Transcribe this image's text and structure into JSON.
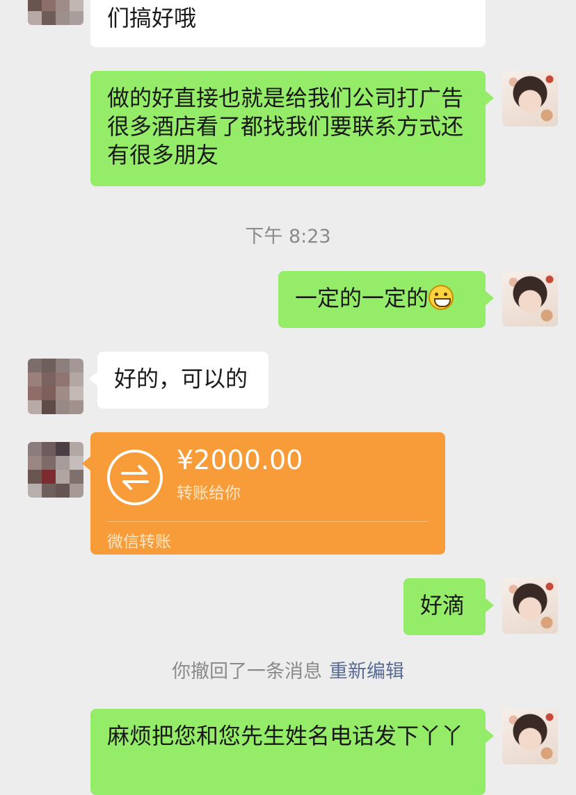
{
  "messages": {
    "m1_text": "们搞好哦",
    "m2_text": "做的好直接也就是给我们公司打广告 很多酒店看了都找我们要联系方式还有很多朋友",
    "time1": "下午 8:23",
    "m3_text": "一定的一定的",
    "m4_text": "好的，可以的",
    "m6_text": "好滴",
    "m7_text": "麻烦把您和您先生姓名电话发下丫丫"
  },
  "transfer": {
    "amount": "¥2000.00",
    "subtitle": "转账给你",
    "footer": "微信转账"
  },
  "recall": {
    "text": "你撤回了一条消息",
    "link": "重新编辑"
  },
  "colors": {
    "background": "#ededed",
    "self_bubble": "#95ec69",
    "other_bubble": "#ffffff",
    "transfer": "#f79c38",
    "link": "#576b95"
  }
}
